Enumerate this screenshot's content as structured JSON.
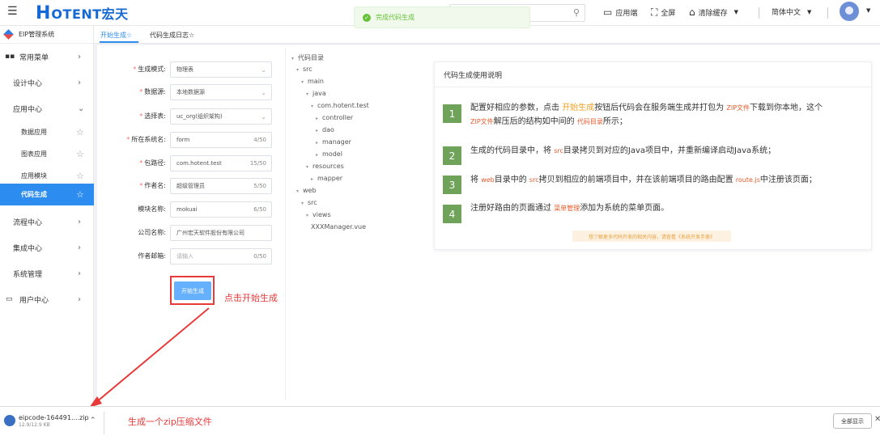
{
  "header": {
    "logo_h": "H",
    "logo_text": "OTENT宏天",
    "toast": "完成代码生成",
    "app_end": "应用端",
    "fullscreen": "全屏",
    "clear_cache": "清除缓存",
    "language": "简体中文"
  },
  "sidebar": {
    "title": "EIP管理系统",
    "common_menu": "常用菜单",
    "design_center": "设计中心",
    "app_center": "应用中心",
    "sub_items": [
      "数据应用",
      "图表应用",
      "应用模块",
      "代码生成"
    ],
    "flow_center": "流程中心",
    "integration_center": "集成中心",
    "system_admin": "系统管理",
    "user_center": "用户中心"
  },
  "tabs": [
    "开始生成☆",
    "代码生成日志☆"
  ],
  "form": {
    "rows": [
      {
        "label": "生成模式:",
        "value": "物理表",
        "required": true,
        "type": "select"
      },
      {
        "label": "数据源:",
        "value": "本地数据源",
        "required": true,
        "type": "select"
      },
      {
        "label": "选择表:",
        "value": "uc_org(组织架构)",
        "required": true,
        "type": "select"
      },
      {
        "label": "所在系统名:",
        "value": "form",
        "count": "4/50",
        "required": true,
        "type": "text"
      },
      {
        "label": "包路径:",
        "value": "com.hotent.test",
        "count": "15/50",
        "required": true,
        "type": "text"
      },
      {
        "label": "作者名:",
        "value": "超级管理员",
        "count": "5/50",
        "required": true,
        "type": "text"
      },
      {
        "label": "模块名称:",
        "value": "mokuai",
        "count": "6/50",
        "required": false,
        "type": "text"
      },
      {
        "label": "公司名称:",
        "value": "广州宏天软件股份有限公司",
        "required": false,
        "type": "text"
      },
      {
        "label": "作者邮箱:",
        "placeholder": "请输入",
        "count": "0/50",
        "required": false,
        "type": "text"
      }
    ],
    "generate_button": "开始生成",
    "annotation": "点击开始生成"
  },
  "tree": [
    {
      "label": "代码目录",
      "expanded": true
    },
    {
      "label": "src",
      "expanded": true
    },
    {
      "label": "main",
      "expanded": true
    },
    {
      "label": "java",
      "expanded": true
    },
    {
      "label": "com.hotent.test",
      "expanded": true
    },
    {
      "label": "controller",
      "expanded": false
    },
    {
      "label": "dao",
      "expanded": false
    },
    {
      "label": "manager",
      "expanded": false
    },
    {
      "label": "model",
      "expanded": false
    },
    {
      "label": "resources",
      "expanded": true
    },
    {
      "label": "mapper",
      "expanded": false
    },
    {
      "label": "web",
      "expanded": true
    },
    {
      "label": "src",
      "expanded": true
    },
    {
      "label": "views",
      "expanded": true
    },
    {
      "label": "XXXManager.vue",
      "leaf": true
    }
  ],
  "card": {
    "title": "代码生成使用说明",
    "steps": [
      {
        "num": "1",
        "line1_a": "配置好相应的参数，点击 ",
        "line1_hl": "开始生成",
        "line1_b": "按钮后代码会在服务端生成并打包为 ",
        "line1_code": "ZIP文件",
        "line1_c": "下载到你本地，这个",
        "line2_code": "ZIP文件",
        "line2_a": "解压后的结构如中间的 ",
        "line2_hl": "代码目录",
        "line2_b": "所示；"
      },
      {
        "num": "2",
        "a": "生成的代码目录中，将 ",
        "code": "src",
        "b": "目录拷贝到对应的Java项目中，并重新编译启动Java系统；"
      },
      {
        "num": "3",
        "a": "将 ",
        "code1": "web",
        "b": "目录中的 ",
        "code2": "src",
        "c": "拷贝到相应的前端项目中，并在该前端项目的路由配置 ",
        "code3": "route.js",
        "d": "中注册该页面；"
      },
      {
        "num": "4",
        "a": "注册好路由的页面通过 ",
        "hl": "菜单管理",
        "b": "添加为系统的菜单页面。"
      }
    ],
    "footer": "想了解更多代码开发的相关内容，请查看《系统开发手册》"
  },
  "download": {
    "filename": "eipcode-164491....zip",
    "size": "12.9/12.9 KB",
    "annotation": "生成一个zip压缩文件",
    "show_all": "全部显示"
  },
  "colors": {
    "accent": "#2d8cf0",
    "annotation_red": "#e83a3a",
    "step_green": "#6fa35a",
    "toast_green": "#67c23a"
  }
}
